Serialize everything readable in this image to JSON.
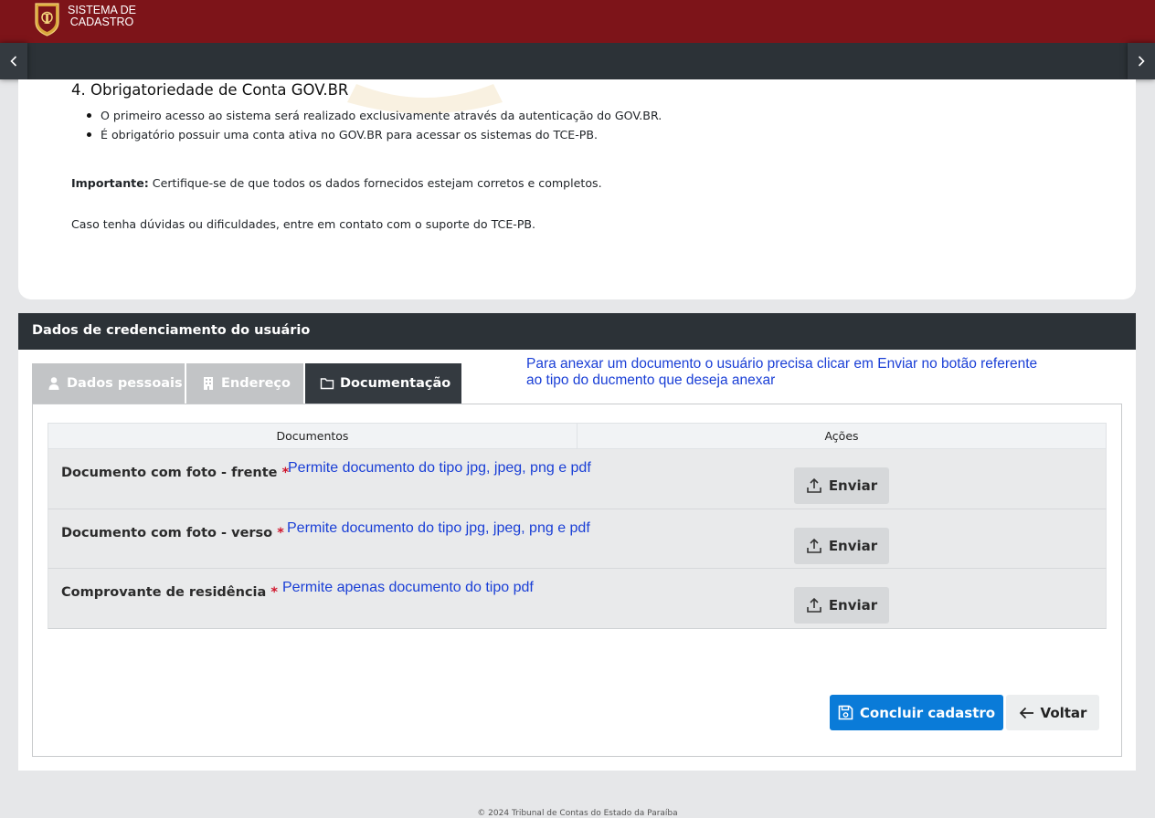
{
  "app": {
    "brand_line1": "SISTEMA DE",
    "brand_line2": "CADASTRO"
  },
  "info": {
    "title": "4. Obrigatoriedade de Conta GOV.BR",
    "items": [
      "O primeiro acesso ao sistema será realizado exclusivamente através da autenticação do GOV.BR.",
      "É obrigatório possuir uma conta ativa no GOV.BR para acessar os sistemas do TCE-PB."
    ],
    "important_label": "Importante:",
    "important_text": " Certifique-se de que todos os dados fornecidos estejam corretos e completos.",
    "contact": "Caso tenha dúvidas ou dificuldades, entre em contato com o suporte do TCE-PB."
  },
  "panel": {
    "header": "Dados de credenciamento do usuário",
    "tabs": [
      {
        "label": "Dados pessoais",
        "icon": "user-icon",
        "active": false
      },
      {
        "label": "Endereço",
        "icon": "building-icon",
        "active": false
      },
      {
        "label": "Documentação",
        "icon": "folder-icon",
        "active": true
      }
    ],
    "hint_line1": "Para anexar um documento o usuário precisa clicar em Enviar no botão referente",
    "hint_line2": "ao tipo do ducmento que deseja anexar"
  },
  "table": {
    "col_documents": "Documentos",
    "col_actions": "Ações",
    "rows": [
      {
        "label": "Documento com foto - frente",
        "required": "*",
        "hint": "Permite documento do tipo jpg, jpeg, png e pdf",
        "action": "Enviar"
      },
      {
        "label": "Documento com foto - verso",
        "required": "*",
        "hint": "Permite documento do tipo jpg, jpeg, png e pdf",
        "action": "Enviar"
      },
      {
        "label": "Comprovante de residência",
        "required": "*",
        "hint": "Permite apenas documento do tipo pdf",
        "action": "Enviar"
      }
    ]
  },
  "actions": {
    "submit": "Concluir cadastro",
    "back": "Voltar"
  },
  "footer": "© 2024 Tribunal de Contas do Estado da Paraíba",
  "colors": {
    "topbar": "#7d1419",
    "dark": "#2c3237",
    "primary": "#0a7bd8",
    "hint": "#1a3fd6",
    "required": "#d0152b"
  }
}
